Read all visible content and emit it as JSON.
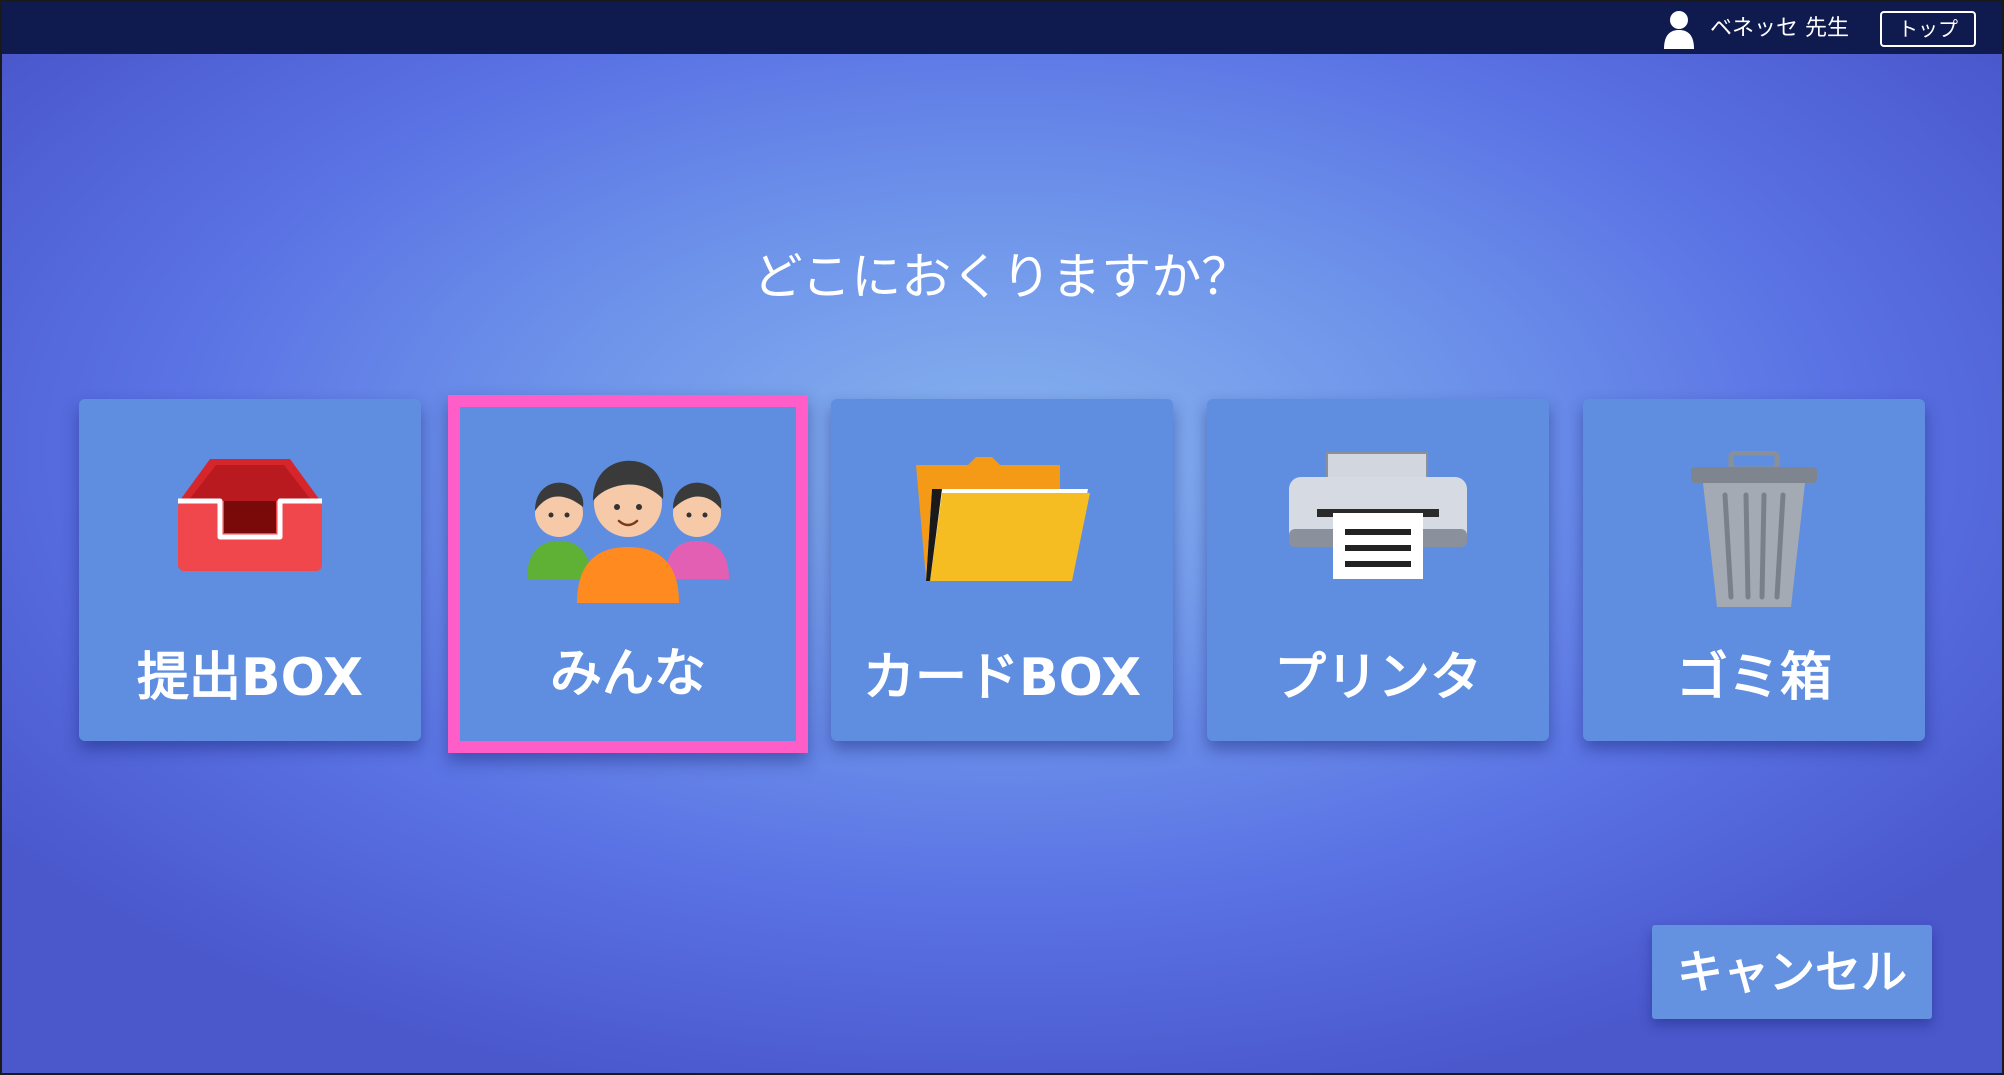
{
  "header": {
    "user_name": "ベネッセ 先生",
    "top_button_label": "トップ",
    "user_icon": "person-icon"
  },
  "question": "どこにおくりますか？",
  "destinations": [
    {
      "label": "提出BOX",
      "icon": "inbox-tray-icon",
      "selected": false
    },
    {
      "label": "みんな",
      "icon": "people-group-icon",
      "selected": true
    },
    {
      "label": "カードBOX",
      "icon": "folder-icon",
      "selected": false
    },
    {
      "label": "プリンタ",
      "icon": "printer-icon",
      "selected": false
    },
    {
      "label": "ゴミ箱",
      "icon": "trash-can-icon",
      "selected": false
    }
  ],
  "cancel_label": "キャンセル",
  "colors": {
    "topbar": "#0f1a4e",
    "tile": "#5f8ee0",
    "selection_border": "#ff5ec8",
    "cancel_button": "#6592e0"
  }
}
